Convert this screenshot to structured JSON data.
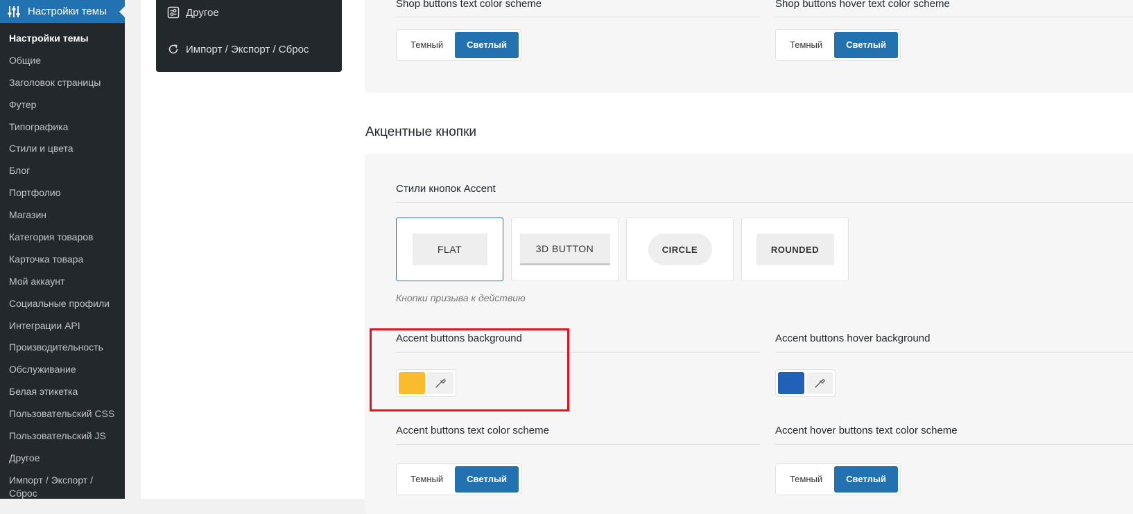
{
  "sidebar": {
    "header_label": "Настройки темы",
    "items": [
      {
        "label": "Настройки темы",
        "current": true
      },
      {
        "label": "Общие"
      },
      {
        "label": "Заголовок страницы"
      },
      {
        "label": "Футер"
      },
      {
        "label": "Типографика"
      },
      {
        "label": "Стили и цвета"
      },
      {
        "label": "Блог"
      },
      {
        "label": "Портфолио"
      },
      {
        "label": "Магазин"
      },
      {
        "label": "Категория товаров"
      },
      {
        "label": "Карточка товара"
      },
      {
        "label": "Мой аккаунт"
      },
      {
        "label": "Социальные профили"
      },
      {
        "label": "Интеграции API"
      },
      {
        "label": "Производительность"
      },
      {
        "label": "Обслуживание"
      },
      {
        "label": "Белая этикетка"
      },
      {
        "label": "Пользовательский CSS"
      },
      {
        "label": "Пользовательский JS"
      },
      {
        "label": "Другое"
      },
      {
        "label": "Импорт / Экспорт / Сброс"
      }
    ]
  },
  "theme_nav": {
    "other_label": "Другое",
    "import_label": "Импорт / Экспорт / Сброс"
  },
  "top_panel": {
    "shop_text_label": "Shop buttons text color scheme",
    "shop_hover_text_label": "Shop buttons hover text color scheme",
    "dark_label": "Темный",
    "light_label": "Светлый"
  },
  "accent": {
    "section_title": "Акцентные кнопки",
    "styles_label": "Стили кнопок Accent",
    "styles": [
      "FLAT",
      "3D BUTTON",
      "CIRCLE",
      "ROUNDED"
    ],
    "hint": "Кнопки призыва к действию",
    "bg_label": "Accent buttons background",
    "bg_color": "#fbbb2e",
    "hover_bg_label": "Accent buttons hover background",
    "hover_bg_color": "#2261b8",
    "text_scheme_label": "Accent buttons text color scheme",
    "hover_text_scheme_label": "Accent hover buttons text color scheme",
    "dark_label": "Темный",
    "light_label": "Светлый"
  },
  "colors": {
    "sidebar_bg": "#23282d",
    "accent_blue": "#2271b1",
    "highlight_red": "#e0141e"
  }
}
